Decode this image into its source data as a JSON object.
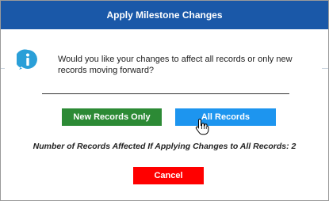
{
  "dialog": {
    "title": "Apply Milestone Changes",
    "message": "Would you like your changes to affect all records or only new records moving forward?",
    "icon": "info-icon",
    "buttons": {
      "new_records_label": "New Records Only",
      "all_records_label": "All Records",
      "cancel_label": "Cancel"
    },
    "affected_text": "Number of Records Affected If Applying Changes to All Records: 2"
  },
  "colors": {
    "titlebar": "#1a58a8",
    "new_records_button": "#2c8a35",
    "all_records_button": "#1d95ef",
    "cancel_button": "#ff0000",
    "info_icon": "#2a9fd8"
  }
}
